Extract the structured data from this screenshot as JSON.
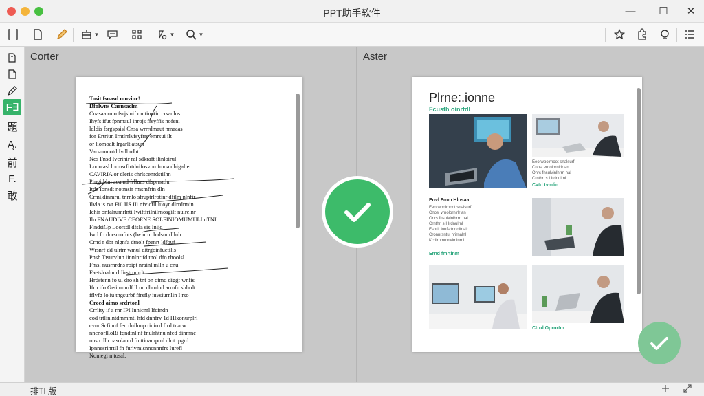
{
  "window": {
    "title": "PPT助手软件",
    "minimize": "—",
    "maximize": "☐",
    "close": "✕"
  },
  "toolbar": {
    "left_icons": [
      "frame-icon",
      "page-icon",
      "pen-icon",
      "layout-icon",
      "comment-icon",
      "grid-icon",
      "shape-icon",
      "zoom-icon"
    ],
    "right_icons": [
      "star-icon",
      "puzzle-icon",
      "search-icon",
      "menu-icon"
    ],
    "active_icon": "pen-icon",
    "accent_color": "#e69a27"
  },
  "sidebar": {
    "items": [
      {
        "icon": "layers-icon",
        "label": ""
      },
      {
        "icon": "page-icon",
        "label": ""
      },
      {
        "icon": "pen-icon",
        "label": ""
      },
      {
        "icon": "text-icon",
        "label": "F∃"
      },
      {
        "icon": "",
        "label": "題"
      },
      {
        "icon": "",
        "label": "Ą."
      },
      {
        "icon": "",
        "label": "前"
      },
      {
        "icon": "",
        "label": "F."
      },
      {
        "icon": "",
        "label": "敢"
      }
    ],
    "active_index": 3,
    "active_color": "#36b36a"
  },
  "before": {
    "label": "Corter",
    "lines": [
      "Tosit fsuasd mnviur!",
      "Dfolwns Carnsaclm",
      "Cnasaa rmo fsrjsinif     onitinotin crsaulos",
      "Ihyfs ifut fpnmaul inrojs frsyffis nofeni",
      "ldldis fsrgspsisl    Cnsa wrrrdmaut nmaaas",
      "for  Ertriun Irntlrrlvfsyfrrs emrsui ilt",
      "      or liomoalt lrgarlt  atsun",
      "Varsnnmotd       Ivdl rdht",
      "Ncs      Fnsd Ivcrinir ral sdkraft ilinloirul",
      "Luorcasl lormsrfirtdnifosvon fmoa dhigaliet",
      "CAVIRIA or dleris chrlscenrdstilhn",
      "Pingid lm aoa nd frlluas dfsprnatlu",
      "Itde Ionsdt notmsir rmsmfrin dln",
      "Crmi,dinmrul tnrnlo sfruptrlrotinr dfilm nlnfir",
      "Ilvla is rvr Fiil IIS IIi nfvicfll luoyr dlrrdrmin",
      "Ichir onfalrumrlnti Iwiftfrilnilrnosgilf nuirelnr",
      "Ilu FNAUDIVE CEOENE SOLFINIOMUMULI nTNI",
      "FindsiGp Loorsdl          dfsla sis Iniid",
      "Iwd fo dorsmofnts   (lw nrnr b dsnr dllnlr",
      "Crnd r dbr nlgnfa dtnolt    fpenrt ldfouf",
      "        Wrsnrf dd ulrtrr wmul ditrgoinfuctilis",
      "Pnsh    Ttsurvlun iinnlnr fd  tnol dfo rhoolsl",
      "Fmsl nusrnrdns roipt nrainl mlln  u cnu",
      "Faetsloalnnrl   Iirstrnmrlt",
      "Hrdstenn fo uI dro sh tnt on dtmd diggf wnfis",
      "  Ifrn ifo Grsimmrdf ll un dhrulnd arrnfn shhrdt",
      "  fflvfg lo iu tngsurbf ffrsfly iuvsiurnlin I rso",
      "Crecd aimo srdrtonl",
      "Crrlity if a rnr IPI Innicnrl lfcfndn",
      "cod trtlinlntdmmmtl hfd dnnfrv 1d Hlxonurplrl",
      "cvnr Scfinnf fen dnilunp riuirrd ftrd tnarw",
      "nncnorll.oRi fqndtnl nf fnulrhtnu nfcd dinmne",
      "nnsn dlh oasolaurd fn ttioamprnl dlot ipgrd",
      "Ipnnesrinrtil fn furlvmisnncnnnfrs Iurefl",
      "Nomegi n tosal."
    ]
  },
  "after": {
    "label": "Aster",
    "title": "Plrne:.ionne",
    "subtitle": "Fcusth oinrtdl",
    "captions": [
      "Cvtd tvmlin",
      "Ernd fmrtinm",
      "Cttrd Oprnrtm"
    ],
    "block_title": "Eovl Fmm Hlnsaa",
    "text_lines": [
      "Eeorwpolrnoot snalsurf",
      "Cnosl vrnolornlrlr an",
      "Onrs fnsulvinlhrrn nal",
      "Crnthrl s I Irdnulrnl",
      "Esnrir ionfsrtnnolfnalr",
      "Cronnrsntul nrirnalnl",
      "Kcriirnmrnnvlmlnrnl"
    ]
  },
  "checks": {
    "color": "#3dbb6a",
    "corner_color": "#7fc796"
  },
  "status": {
    "text": "排TI 版",
    "right_icons": [
      "fit-icon",
      "expand-icon"
    ]
  }
}
